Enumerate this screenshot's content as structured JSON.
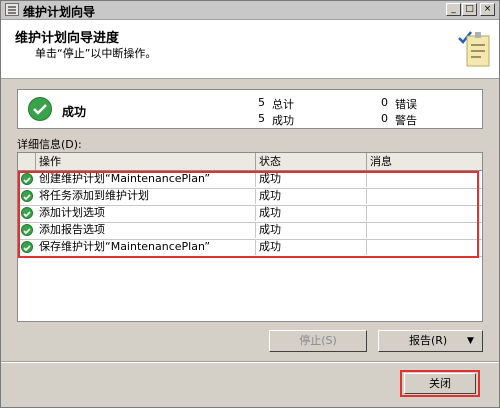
{
  "window": {
    "title": "维护计划向导",
    "controls": {
      "minimize": "_",
      "maximize": "□",
      "close": "×"
    }
  },
  "header": {
    "title": "维护计划向导进度",
    "subtitle": "单击“停止”以中断操作。"
  },
  "summary": {
    "status": "成功",
    "total_count": "5",
    "total_label": "总计",
    "success_count": "5",
    "success_label": "成功",
    "error_count": "0",
    "error_label": "错误",
    "warning_count": "0",
    "warning_label": "警告"
  },
  "details": {
    "label": "详细信息(D):",
    "columns": {
      "action": "操作",
      "status": "状态",
      "message": "消息"
    },
    "rows": [
      {
        "action": "创建维护计划“MaintenancePlan”",
        "status": "成功",
        "message": ""
      },
      {
        "action": "将任务添加到维护计划",
        "status": "成功",
        "message": ""
      },
      {
        "action": "添加计划选项",
        "status": "成功",
        "message": ""
      },
      {
        "action": "添加报告选项",
        "status": "成功",
        "message": ""
      },
      {
        "action": "保存维护计划“MaintenancePlan”",
        "status": "成功",
        "message": ""
      }
    ]
  },
  "buttons": {
    "stop": "停止(S)",
    "report": "报告(R)",
    "report_dropdown": "▼",
    "close": "关闭"
  },
  "colors": {
    "success": "#3aa24a",
    "highlight": "#e03030"
  }
}
